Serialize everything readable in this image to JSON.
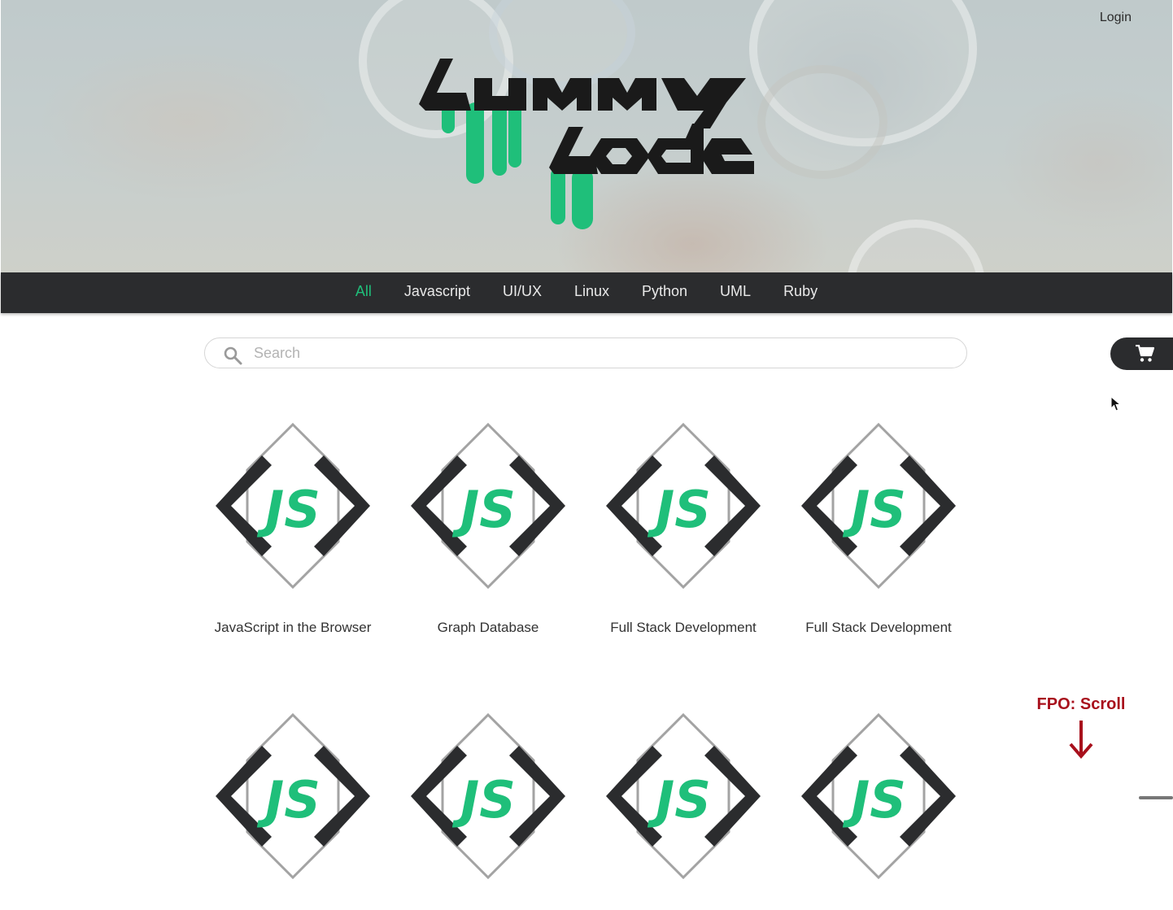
{
  "header": {
    "login_label": "Login",
    "logo_alt": "Gummy Code"
  },
  "nav": {
    "items": [
      {
        "label": "All",
        "active": true
      },
      {
        "label": "Javascript",
        "active": false
      },
      {
        "label": "UI/UX",
        "active": false
      },
      {
        "label": "Linux",
        "active": false
      },
      {
        "label": "Python",
        "active": false
      },
      {
        "label": "UML",
        "active": false
      },
      {
        "label": "Ruby",
        "active": false
      }
    ]
  },
  "search": {
    "placeholder": "Search",
    "value": ""
  },
  "cart": {
    "icon": "cart-icon"
  },
  "courses": [
    {
      "title": "JavaScript in the Browser",
      "badge_text": "JS"
    },
    {
      "title": "Graph Database",
      "badge_text": "JS"
    },
    {
      "title": "Full Stack Development",
      "badge_text": "JS"
    },
    {
      "title": "Full Stack Development",
      "badge_text": "JS"
    },
    {
      "title": "",
      "badge_text": "JS"
    },
    {
      "title": "",
      "badge_text": "JS"
    },
    {
      "title": "",
      "badge_text": "JS"
    },
    {
      "title": "",
      "badge_text": "JS"
    }
  ],
  "fpo_note": {
    "label": "FPO: Scroll"
  },
  "colors": {
    "accent_green": "#1fbf7a",
    "nav_bg": "#2b2c2e",
    "badge_dark": "#2b2c2e",
    "badge_outline": "#a3a3a3",
    "fpo_red": "#a8101c"
  }
}
